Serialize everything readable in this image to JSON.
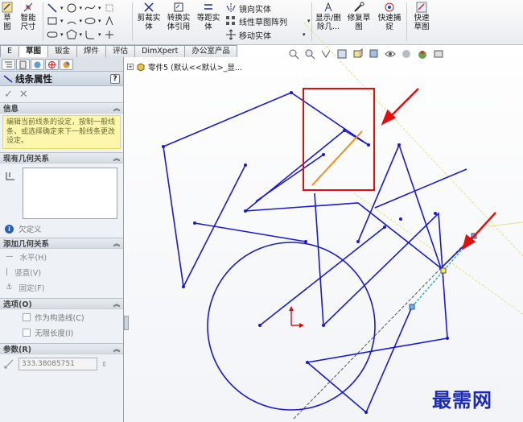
{
  "ribbon": {
    "smart_dim_label": "智能尺寸",
    "sketch_label": "草图",
    "trim_label": "剪裁实体",
    "convert_label": "转换实体引用",
    "offset_label": "等距实体",
    "mirror_label": "镜向实体",
    "linear_pattern_label": "线性草图阵列",
    "move_label": "移动实体",
    "display_delete_label": "显示/删除几...",
    "repair_label": "修复草图",
    "quick_snaps_label": "快速捕捉",
    "rapid_sketch_label": "快速草图"
  },
  "tabs": [
    "E",
    "草图",
    "钣金",
    "焊件",
    "评估",
    "DimXpert",
    "办公室产品"
  ],
  "active_tab": "草图",
  "tree": {
    "part_label": "零件5  (默认<<默认>_显..."
  },
  "property_manager": {
    "title": "线条属性",
    "help": "?",
    "ok_symbol": "✓",
    "cancel_symbol": "✕",
    "info_header": "信息",
    "info_text": "编辑当前线条的设定，按制一般线条，或选择确定来下一般线条更改设定。",
    "existing_relations_header": "现有几何关系",
    "under_defined": "欠定义",
    "add_relations_header": "添加几何关系",
    "relations": [
      {
        "symbol": "—",
        "label": "水平(H)"
      },
      {
        "symbol": "|",
        "label": "竖直(V)"
      },
      {
        "symbol": "⚓",
        "label": "固定(F)"
      }
    ],
    "options_header": "选项(O)",
    "options": [
      "作为构造线(C)",
      "无限长度(I)"
    ],
    "params_header": "参数(R)",
    "length_value": "333.38085751"
  },
  "watermark": "最需网",
  "colors": {
    "sketch_line": "#1a1acc",
    "selected_line": "#f08c1e",
    "highlight_box": "#e01010",
    "arrow": "#e01010"
  }
}
